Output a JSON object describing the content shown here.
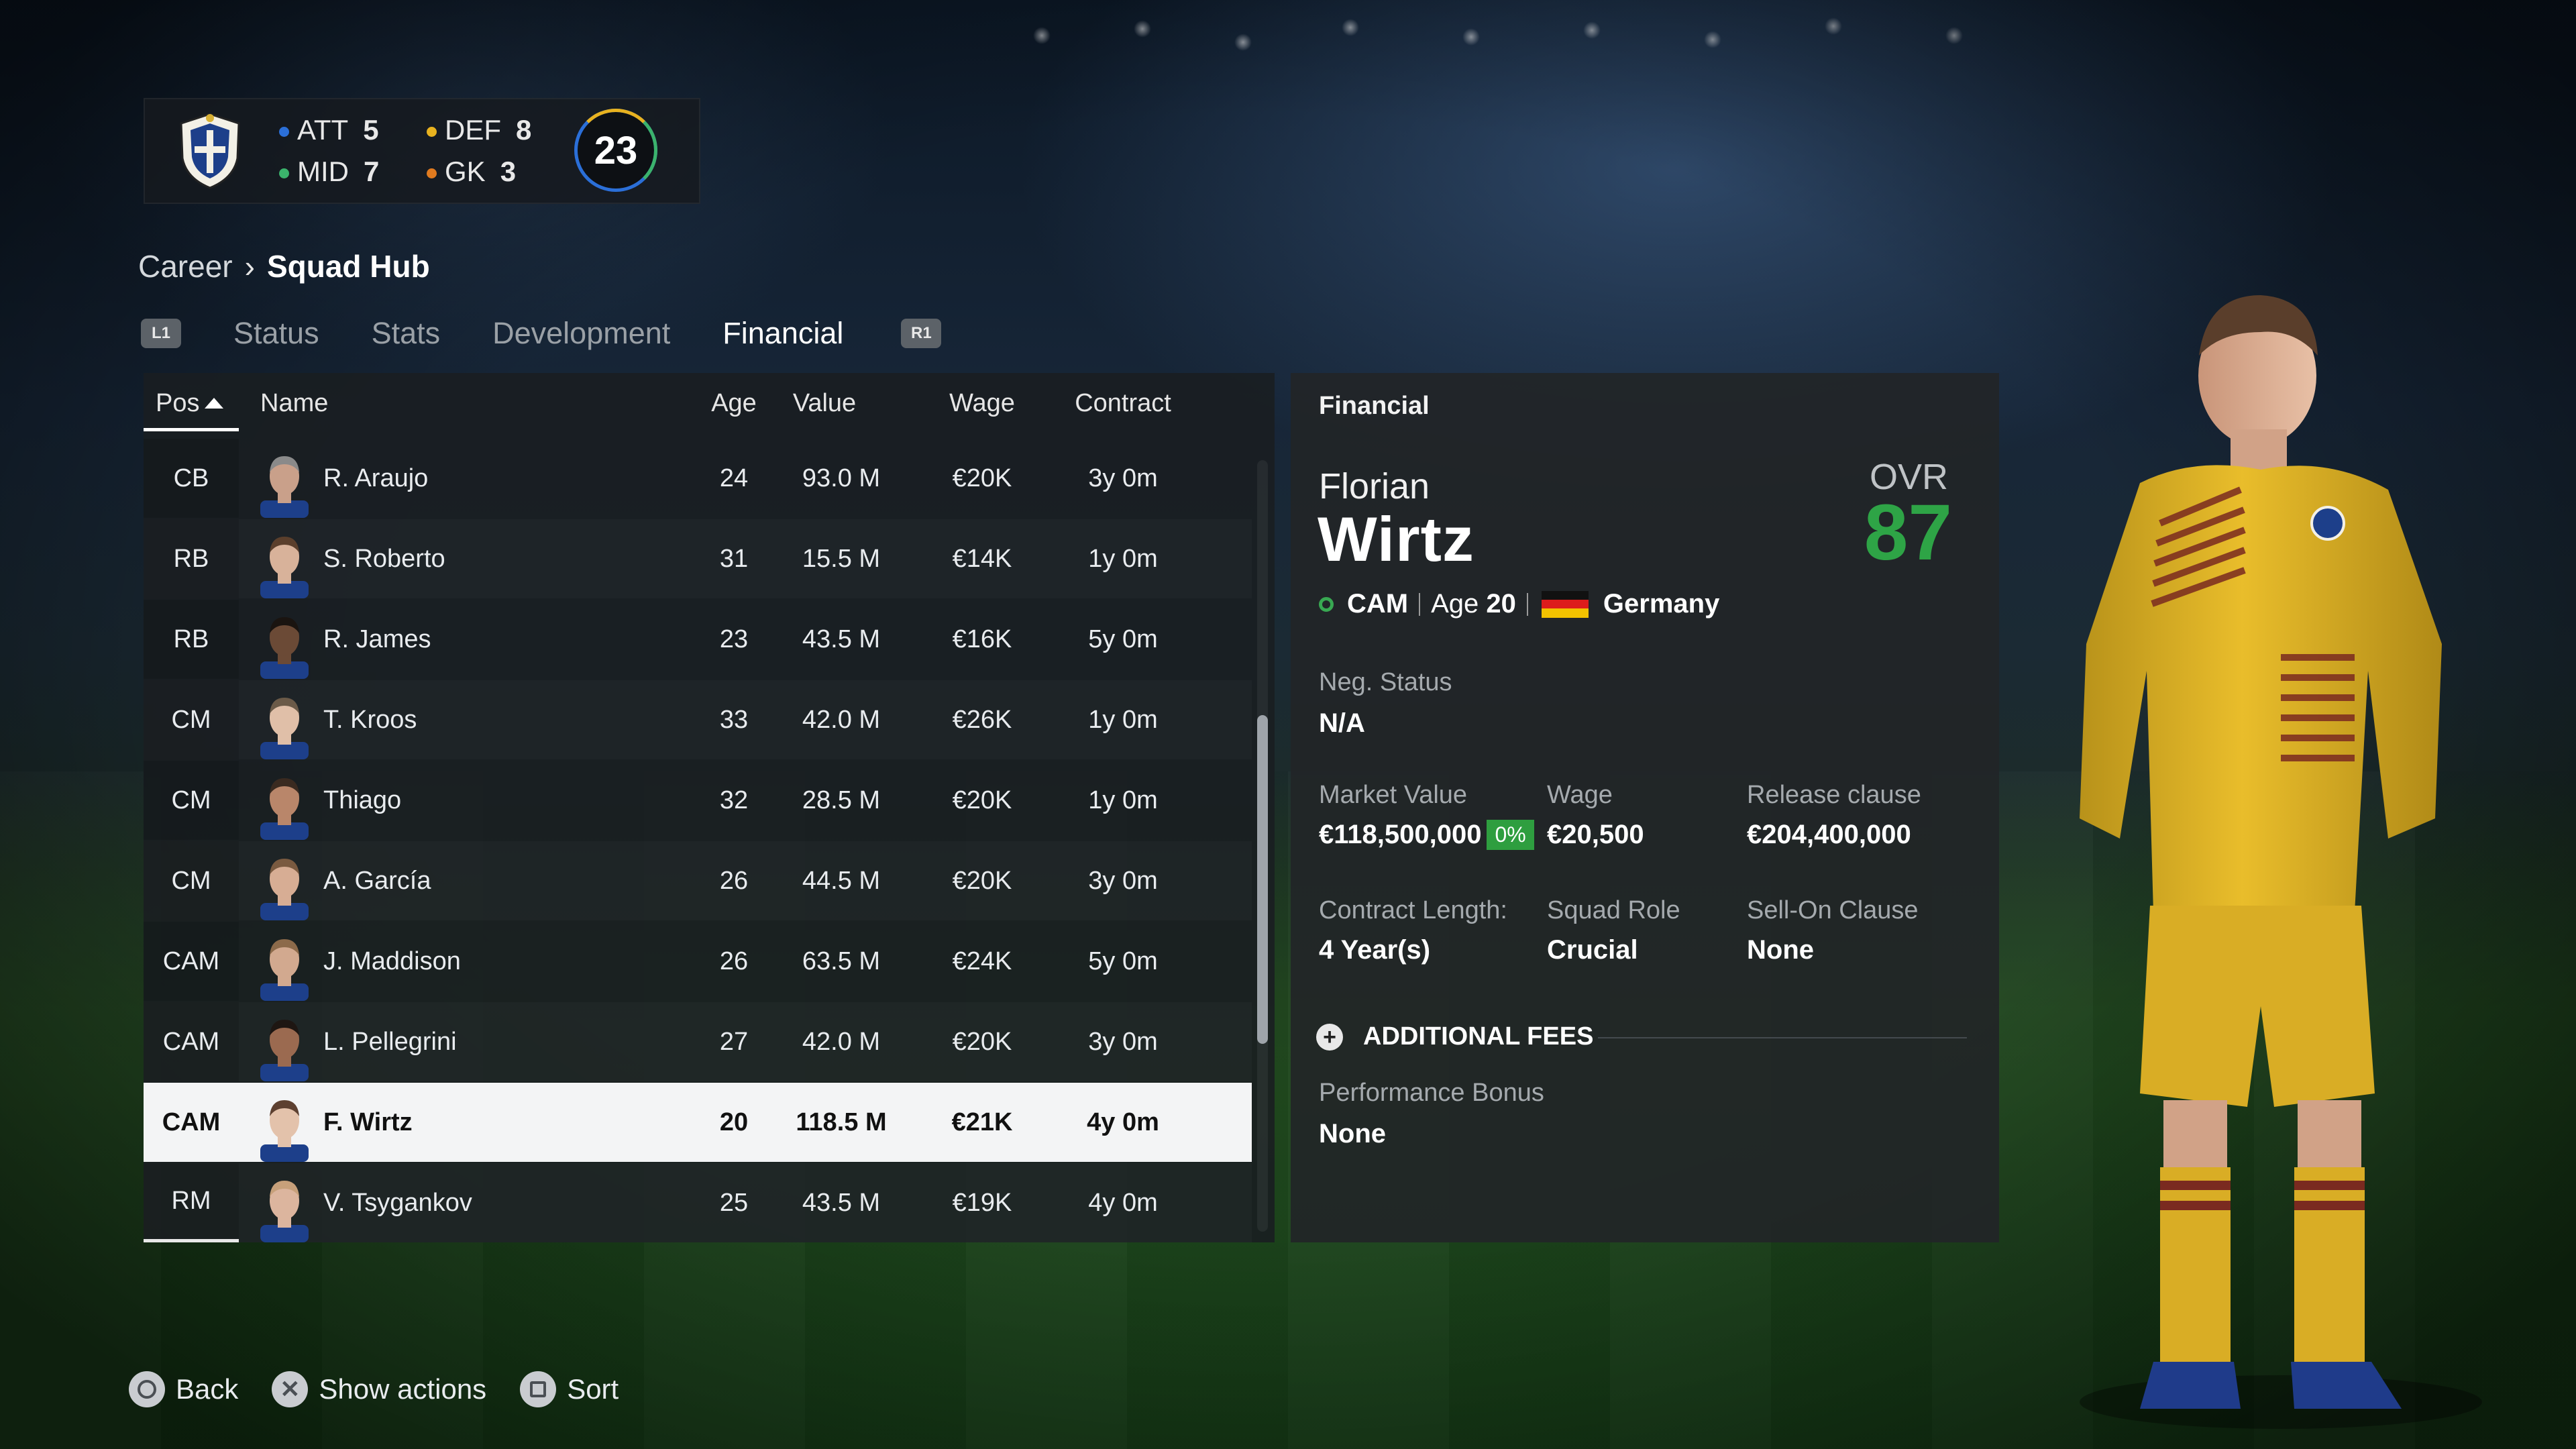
{
  "squad_summary": {
    "att_label": "ATT",
    "att_count": "5",
    "def_label": "DEF",
    "def_count": "8",
    "mid_label": "MID",
    "mid_count": "7",
    "gk_label": "GK",
    "gk_count": "3",
    "total": "23",
    "colors": {
      "att": "#2b6fd8",
      "def": "#e8b21f",
      "mid": "#3bb36c",
      "gk": "#e07a1f"
    }
  },
  "breadcrumb": {
    "parent": "Career",
    "current": "Squad Hub"
  },
  "tabs": {
    "left_button": "L1",
    "right_button": "R1",
    "items": [
      {
        "label": "Status"
      },
      {
        "label": "Stats"
      },
      {
        "label": "Development"
      },
      {
        "label": "Financial",
        "active": true
      }
    ]
  },
  "table": {
    "headers": {
      "pos": "Pos",
      "name": "Name",
      "age": "Age",
      "value": "Value",
      "wage": "Wage",
      "contract": "Contract"
    },
    "sort_column": "Pos",
    "rows": [
      {
        "pos": "CB",
        "name": "R. Araujo",
        "age": "24",
        "value": "93.0 M",
        "wage": "€20K",
        "contract": "3y 0m"
      },
      {
        "pos": "RB",
        "name": "S. Roberto",
        "age": "31",
        "value": "15.5 M",
        "wage": "€14K",
        "contract": "1y 0m"
      },
      {
        "pos": "RB",
        "name": "R. James",
        "age": "23",
        "value": "43.5 M",
        "wage": "€16K",
        "contract": "5y 0m"
      },
      {
        "pos": "CM",
        "name": "T. Kroos",
        "age": "33",
        "value": "42.0 M",
        "wage": "€26K",
        "contract": "1y 0m"
      },
      {
        "pos": "CM",
        "name": "Thiago",
        "age": "32",
        "value": "28.5 M",
        "wage": "€20K",
        "contract": "1y 0m"
      },
      {
        "pos": "CM",
        "name": "A. García",
        "age": "26",
        "value": "44.5 M",
        "wage": "€20K",
        "contract": "3y 0m"
      },
      {
        "pos": "CAM",
        "name": "J. Maddison",
        "age": "26",
        "value": "63.5 M",
        "wage": "€24K",
        "contract": "5y 0m"
      },
      {
        "pos": "CAM",
        "name": "L. Pellegrini",
        "age": "27",
        "value": "42.0 M",
        "wage": "€20K",
        "contract": "3y 0m"
      },
      {
        "pos": "CAM",
        "name": "F. Wirtz",
        "age": "20",
        "value": "118.5 M",
        "wage": "€21K",
        "contract": "4y 0m",
        "selected": true
      },
      {
        "pos": "RM",
        "name": "V. Tsygankov",
        "age": "25",
        "value": "43.5 M",
        "wage": "€19K",
        "contract": "4y 0m"
      }
    ]
  },
  "panel": {
    "title": "Financial",
    "first_name": "Florian",
    "last_name": "Wirtz",
    "ovr_label": "OVR",
    "ovr": "87",
    "position": "CAM",
    "age_label": "Age",
    "age": "20",
    "nation": "Germany",
    "neg_status_label": "Neg. Status",
    "neg_status": "N/A",
    "market_value_label": "Market Value",
    "market_value": "€118,500,000",
    "market_value_change": "0%",
    "wage_label": "Wage",
    "wage": "€20,500",
    "release_clause_label": "Release clause",
    "release_clause": "€204,400,000",
    "contract_length_label": "Contract Length:",
    "contract_length": "4 Year(s)",
    "squad_role_label": "Squad Role",
    "squad_role": "Crucial",
    "sell_on_label": "Sell-On Clause",
    "sell_on": "None",
    "additional_fees_label": "ADDITIONAL FEES",
    "performance_bonus_label": "Performance Bonus",
    "performance_bonus": "None"
  },
  "footer": {
    "back": "Back",
    "show_actions": "Show actions",
    "sort": "Sort"
  }
}
